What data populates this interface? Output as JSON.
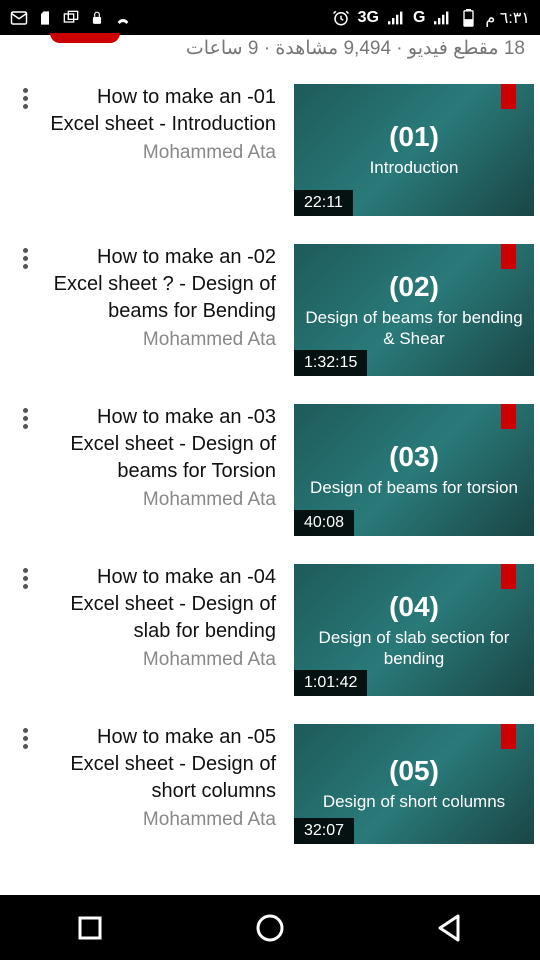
{
  "status": {
    "time": "٦:٣١ م",
    "network1": "3G",
    "network2": "G"
  },
  "playlist": {
    "info": "18 مقطع فيديو · 9,494 مشاهدة · 9 ساعات"
  },
  "videos": [
    {
      "title": "How to make an -01 Excel sheet - Introduction",
      "author": "Mohammed Ata",
      "thumbNum": "(01)",
      "thumbLabel": "Introduction",
      "duration": "22:11"
    },
    {
      "title": "How to make an -02 Excel sheet ? - Design of beams for Bending",
      "author": "Mohammed Ata",
      "thumbNum": "(02)",
      "thumbLabel": "Design of beams for bending & Shear",
      "duration": "1:32:15"
    },
    {
      "title": "How to make an -03 Excel sheet - Design of beams for Torsion",
      "author": "Mohammed Ata",
      "thumbNum": "(03)",
      "thumbLabel": "Design of beams for torsion",
      "duration": "40:08"
    },
    {
      "title": "How to make an -04 Excel sheet - Design of slab for bending",
      "author": "Mohammed Ata",
      "thumbNum": "(04)",
      "thumbLabel": "Design of slab section for bending",
      "duration": "1:01:42"
    },
    {
      "title": "How to make an -05 Excel sheet - Design of short columns",
      "author": "Mohammed Ata",
      "thumbNum": "(05)",
      "thumbLabel": "Design of short columns",
      "duration": "32:07"
    }
  ]
}
